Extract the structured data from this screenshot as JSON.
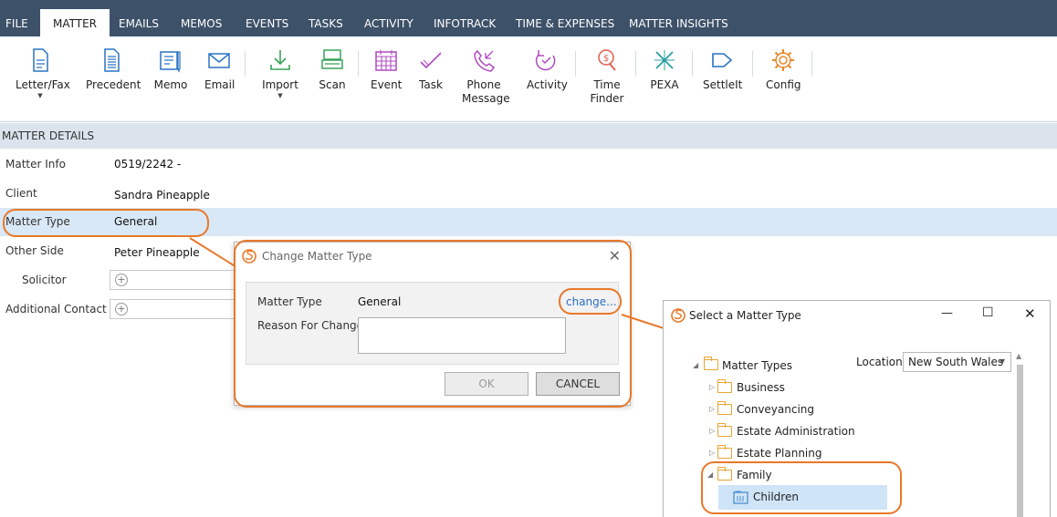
{
  "tabs": [
    "FILE",
    "MATTER",
    "EMAILS",
    "MEMOS",
    "EVENTS",
    "TASKS",
    "ACTIVITY",
    "INFOTRACK",
    "TIME & EXPENSES",
    "MATTER INSIGHTS"
  ],
  "ribbon": {
    "letter_fax": "Letter/Fax",
    "precedent": "Precedent",
    "memo": "Memo",
    "email": "Email",
    "import": "Import",
    "scan": "Scan",
    "event": "Event",
    "task": "Task",
    "phone_message_1": "Phone",
    "phone_message_2": "Message",
    "activity": "Activity",
    "time_finder_1": "Time",
    "time_finder_2": "Finder",
    "pexa": "PEXA",
    "settleit": "SettleIt",
    "config": "Config"
  },
  "details": {
    "header": "MATTER DETAILS",
    "matter_info_label": "Matter Info",
    "matter_info_value": "0519/2242 -",
    "client_label": "Client",
    "client_value": "Sandra Pineapple",
    "matter_type_label": "Matter Type",
    "matter_type_value": "General",
    "other_side_label": "Other Side",
    "other_side_value": "Peter Pineapple",
    "solicitor_label": "Solicitor",
    "additional_contact_label": "Additional Contact"
  },
  "change_dialog": {
    "title": "Change Matter Type",
    "matter_type_label": "Matter Type",
    "matter_type_value": "General",
    "change_link": "change...",
    "reason_label": "Reason For Change",
    "ok": "OK",
    "cancel": "CANCEL"
  },
  "select_window": {
    "title": "Select a Matter Type",
    "location_label": "Location",
    "location_value": "New South Wales",
    "root": "Matter Types",
    "items": [
      "Business",
      "Conveyancing",
      "Estate Administration",
      "Estate Planning",
      "Family"
    ],
    "child": "Children"
  },
  "colors": {
    "tabbar": "#3d5169",
    "highlight": "#e8782a",
    "selected_row": "#d9e8f6"
  }
}
